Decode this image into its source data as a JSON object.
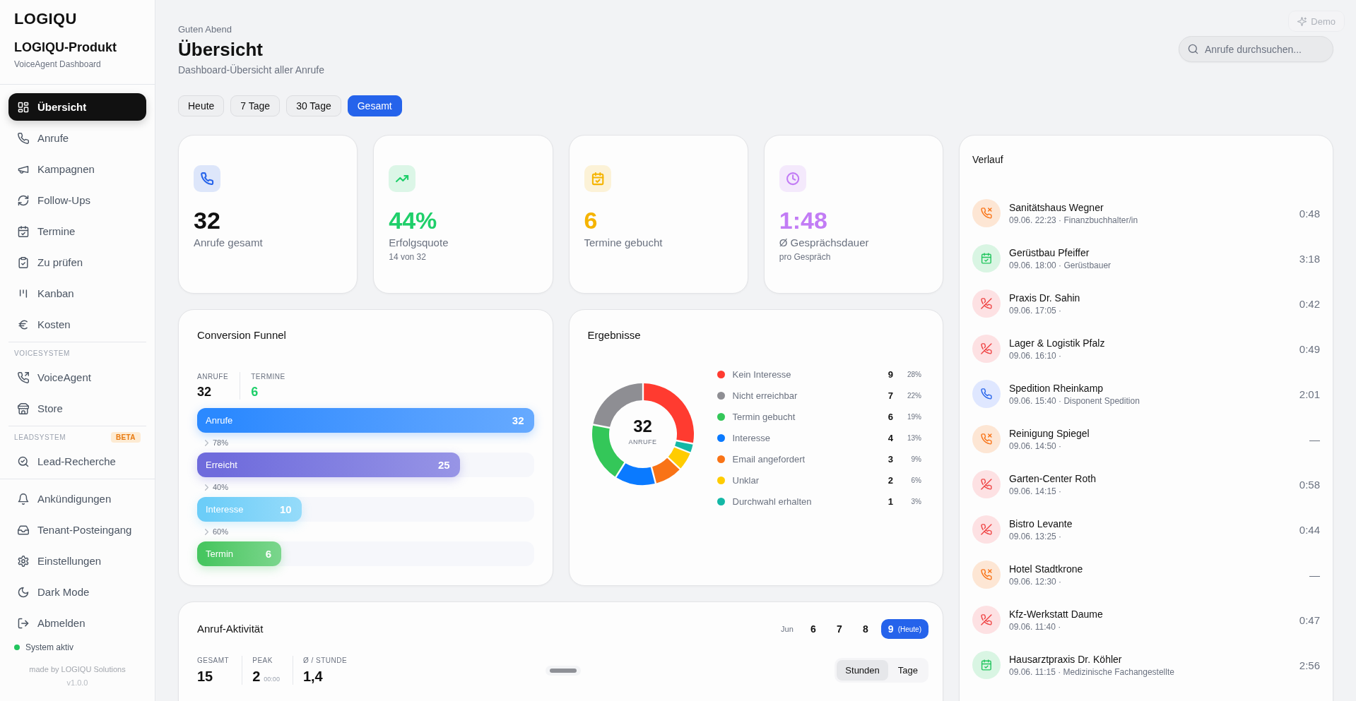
{
  "sidebar": {
    "logo": "LOGIQU",
    "product": "LOGIQU-Produkt",
    "subtitle": "VoiceAgent Dashboard",
    "sections": [
      {
        "items": [
          {
            "label": "Übersicht",
            "selected": true
          },
          {
            "label": "Anrufe",
            "selected": false
          },
          {
            "label": "Kampagnen",
            "selected": false
          },
          {
            "label": "Follow-Ups",
            "selected": false
          },
          {
            "label": "Termine",
            "selected": false
          },
          {
            "label": "Zu prüfen",
            "selected": false
          },
          {
            "label": "Kanban",
            "selected": false
          },
          {
            "label": "Kosten",
            "selected": false
          }
        ]
      },
      {
        "title": "VOICESYSTEM",
        "items": [
          {
            "label": "VoiceAgent",
            "selected": false
          },
          {
            "label": "Store",
            "selected": false
          }
        ]
      },
      {
        "title": "LEADSYSTEM",
        "badge": "BETA",
        "items": [
          {
            "label": "Lead-Recherche",
            "selected": false
          }
        ]
      }
    ],
    "bottom_items": [
      {
        "label": "Ankündigungen",
        "selected": false
      },
      {
        "label": "Tenant-Posteingang",
        "selected": false
      },
      {
        "label": "Einstellungen",
        "selected": false
      },
      {
        "label": "Dark Mode",
        "selected": false
      },
      {
        "label": "Abmelden",
        "selected": false
      }
    ],
    "status": {
      "label": "System aktiv",
      "color": "#22c55e"
    },
    "footer": "made by LOGIQU Solutions",
    "version": "v1.0.0"
  },
  "header": {
    "greeting": "Guten Abend",
    "title": "Übersicht",
    "subtitle": "Dashboard-Übersicht aller Anrufe",
    "demo_button": {
      "label": "Demo",
      "disabled": true
    },
    "search": {
      "placeholder": "Anrufe durchsuchen..."
    }
  },
  "period_tabs": [
    {
      "label": "Heute",
      "selected": false
    },
    {
      "label": "7 Tage",
      "selected": false
    },
    {
      "label": "30 Tage",
      "selected": false
    },
    {
      "label": "Gesamt",
      "selected": true
    }
  ],
  "stat_cards": [
    {
      "value": "32",
      "label": "Anrufe gesamt",
      "color": "#2563eb",
      "value_colored": false
    },
    {
      "value": "44%",
      "label": "Erfolgsquote",
      "sub": "14 von 32",
      "color": "#1fcf6a",
      "value_colored": true
    },
    {
      "value": "6",
      "label": "Termine gebucht",
      "color": "#f5b400",
      "value_colored": true
    },
    {
      "value": "1:48",
      "label": "Ø Gesprächsdauer",
      "sub": "pro Gespräch",
      "color": "#c27cf5",
      "value_colored": true
    }
  ],
  "funnel": {
    "title": "Conversion Funnel",
    "stats": [
      {
        "label": "ANRUFE",
        "value": "32"
      },
      {
        "label": "TERMINE",
        "value": "6",
        "color": "#1fcf6a"
      }
    ],
    "stages": [
      {
        "label": "Anrufe",
        "value": "32",
        "level": 1,
        "color": "#2b89ff",
        "conversion": "78%"
      },
      {
        "label": "Erreicht",
        "value": "25",
        "level": 0.78,
        "color": "#6f6bdc",
        "conversion": "40%"
      },
      {
        "label": "Interesse",
        "value": "10",
        "level": 0.31,
        "color": "#6ccdf8",
        "conversion": "60%"
      },
      {
        "label": "Termin",
        "value": "6",
        "level": 0.25,
        "color": "#47c660"
      }
    ]
  },
  "results": {
    "title": "Ergebnisse",
    "total": "32",
    "total_label": "ANRUFE",
    "chart_data": {
      "type": "donut",
      "categories": [
        "Kein Interesse",
        "Nicht erreichbar",
        "Termin gebucht",
        "Interesse",
        "Email angefordert",
        "Unklar",
        "Durchwahl erhalten"
      ],
      "values": [
        28,
        22,
        19,
        13,
        9,
        6,
        3
      ]
    },
    "legend": [
      {
        "count": "9",
        "percent": "28%",
        "color": "#ff3b30"
      },
      {
        "count": "7",
        "percent": "22%",
        "color": "#8e8e93"
      },
      {
        "count": "6",
        "percent": "19%",
        "color": "#34c759"
      },
      {
        "count": "4",
        "percent": "13%",
        "color": "#0a7aff"
      },
      {
        "count": "3",
        "percent": "9%",
        "color": "#f97316"
      },
      {
        "count": "2",
        "percent": "6%",
        "color": "#ffcc00"
      },
      {
        "count": "1",
        "percent": "3%",
        "color": "#14b8a6"
      }
    ]
  },
  "activity": {
    "title": "Anruf-Aktivität",
    "month": "Jun",
    "days": [
      {
        "label": "6",
        "selected": false
      },
      {
        "label": "7",
        "selected": false
      },
      {
        "label": "8",
        "selected": false
      },
      {
        "label": "9",
        "note": "(Heute)",
        "selected": true
      }
    ],
    "stats": [
      {
        "label": "GESAMT",
        "value": "15"
      },
      {
        "label": "PEAK",
        "value": "2",
        "note": "00:00"
      },
      {
        "label": "Ø / STUNDE",
        "value": "1,4"
      }
    ],
    "views": [
      {
        "label": "Stunden",
        "selected": true
      },
      {
        "label": "Tage",
        "selected": false
      }
    ]
  },
  "history": {
    "title": "Verlauf",
    "items": [
      {
        "name": "Sanitätshaus Wegner",
        "meta": "09.06. 22:23 · Finanzbuchhalter/in",
        "duration": "0:48",
        "kind": "missed"
      },
      {
        "name": "Gerüstbau Pfeiffer",
        "meta": "09.06. 18:00 · Gerüstbauer",
        "duration": "3:18",
        "kind": "appointment"
      },
      {
        "name": "Praxis Dr. Sahin",
        "meta": "09.06. 17:05 ·",
        "duration": "0:42",
        "kind": "declined"
      },
      {
        "name": "Lager & Logistik Pfalz",
        "meta": "09.06. 16:10 ·",
        "duration": "0:49",
        "kind": "declined"
      },
      {
        "name": "Spedition Rheinkamp",
        "meta": "09.06. 15:40 · Disponent Spedition",
        "duration": "2:01",
        "kind": "answered"
      },
      {
        "name": "Reinigung Spiegel",
        "meta": "09.06. 14:50 ·",
        "duration": "—",
        "kind": "missed"
      },
      {
        "name": "Garten-Center Roth",
        "meta": "09.06. 14:15 ·",
        "duration": "0:58",
        "kind": "declined"
      },
      {
        "name": "Bistro Levante",
        "meta": "09.06. 13:25 ·",
        "duration": "0:44",
        "kind": "declined"
      },
      {
        "name": "Hotel Stadtkrone",
        "meta": "09.06. 12:30 ·",
        "duration": "—",
        "kind": "missed"
      },
      {
        "name": "Kfz-Werkstatt Daume",
        "meta": "09.06. 11:40 ·",
        "duration": "0:47",
        "kind": "declined"
      },
      {
        "name": "Hausarztpraxis Dr. Köhler",
        "meta": "09.06. 11:15 · Medizinische Fachangestellte",
        "duration": "2:56",
        "kind": "appointment"
      }
    ]
  }
}
